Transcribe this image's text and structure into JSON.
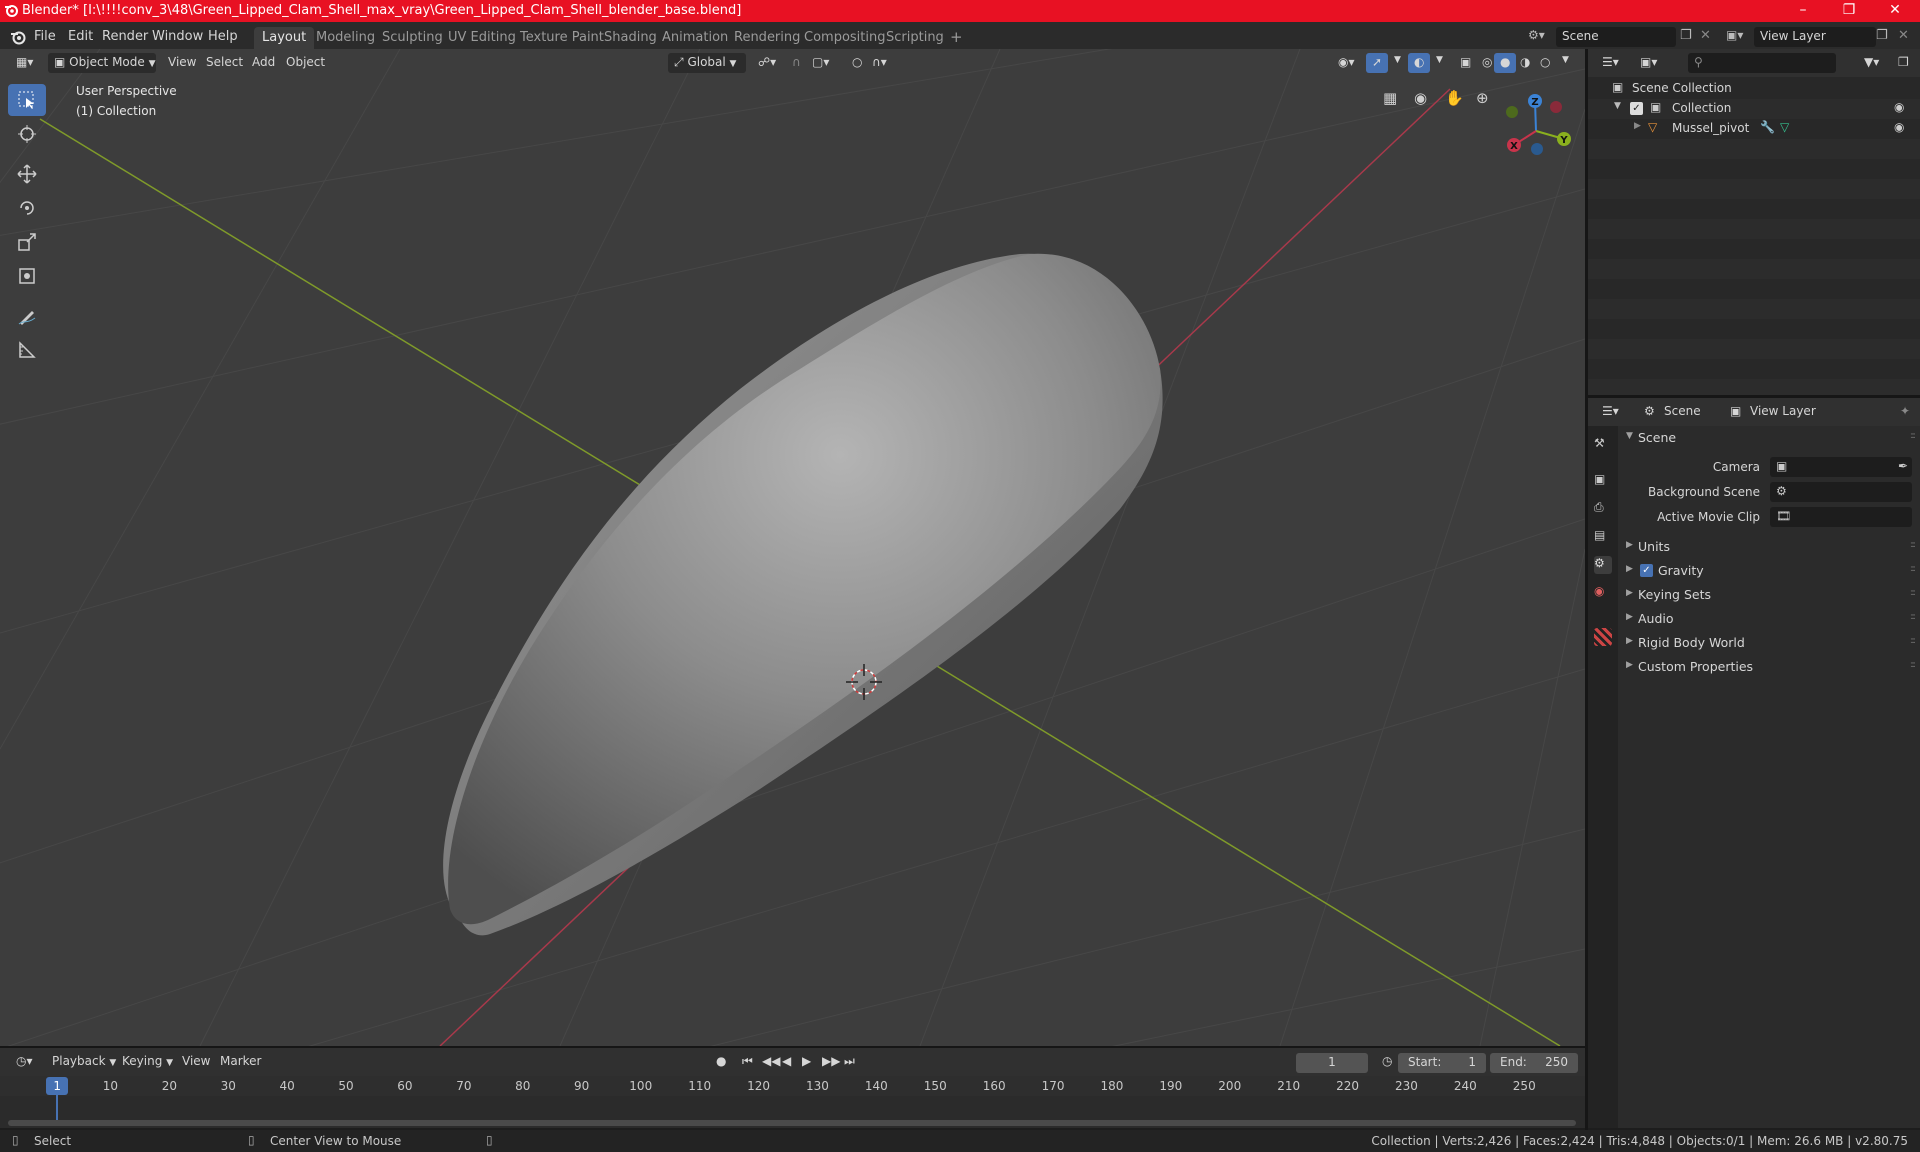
{
  "window": {
    "title": "Blender* [I:\\!!!!conv_3\\48\\Green_Lipped_Clam_Shell_max_vray\\Green_Lipped_Clam_Shell_blender_base.blend]",
    "minimize": "–",
    "maximize": "❐",
    "close": "✕"
  },
  "menu": [
    "File",
    "Edit",
    "Render",
    "Window",
    "Help"
  ],
  "workspaces": [
    "Layout",
    "Modeling",
    "Sculpting",
    "UV Editing",
    "Texture Paint",
    "Shading",
    "Animation",
    "Rendering",
    "Compositing",
    "Scripting"
  ],
  "add_workspace": "+",
  "scene_field": "Scene",
  "view_layer_field": "View Layer",
  "viewport_header": {
    "mode": "Object Mode",
    "menus": [
      "View",
      "Select",
      "Add",
      "Object"
    ],
    "orientation": "Global"
  },
  "viewport_overlay": {
    "perspective": "User Perspective",
    "collection": "(1) Collection"
  },
  "gizmo": {
    "x": "X",
    "y": "Y",
    "z": "Z"
  },
  "outliner": {
    "scene_collection": "Scene Collection",
    "collection": "Collection",
    "object": "Mussel_pivot"
  },
  "properties": {
    "tab_scene": "Scene",
    "tab_view_layer": "View Layer",
    "panel_title": "Scene",
    "camera_label": "Camera",
    "background_scene_label": "Background Scene",
    "active_movie_clip_label": "Active Movie Clip",
    "panels": [
      "Units",
      "Gravity",
      "Keying Sets",
      "Audio",
      "Rigid Body World",
      "Custom Properties"
    ]
  },
  "timeline": {
    "menus": [
      "Playback",
      "Keying",
      "View",
      "Marker"
    ],
    "current_frame": "1",
    "start_label": "Start:",
    "start": "1",
    "end_label": "End:",
    "end": "250",
    "ticks": [
      "1",
      "10",
      "20",
      "30",
      "40",
      "50",
      "60",
      "70",
      "80",
      "90",
      "100",
      "110",
      "120",
      "130",
      "140",
      "150",
      "160",
      "170",
      "180",
      "190",
      "200",
      "210",
      "220",
      "230",
      "240",
      "250"
    ]
  },
  "status": {
    "left": "Select",
    "middle": "Center View to Mouse",
    "right": "Collection | Verts:2,426 | Faces:2,424 | Tris:4,848 | Objects:0/1 | Mem: 26.6 MB | v2.80.75"
  },
  "colors": {
    "accent": "#4772b3",
    "title_bar": "#e81123",
    "x_axis": "#c8344b",
    "y_axis": "#8ab01e",
    "z_axis": "#3b83d6"
  }
}
